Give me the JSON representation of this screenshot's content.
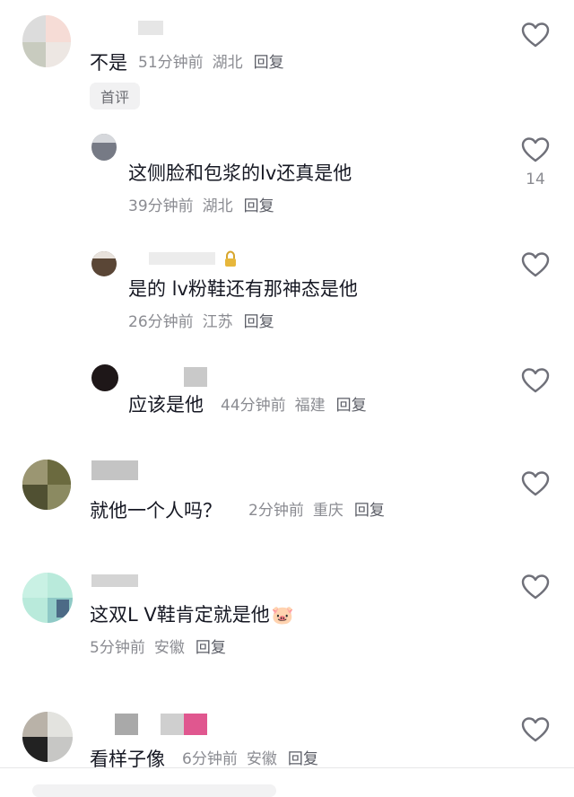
{
  "comments": [
    {
      "text": "不是",
      "time": "51分钟前",
      "location": "湖北",
      "reply_label": "回复",
      "badge": "首评"
    },
    {
      "text": "这侧脸和包浆的lv还真是他",
      "time": "39分钟前",
      "location": "湖北",
      "reply_label": "回复",
      "likes": "14"
    },
    {
      "text": "是的 lv粉鞋还有那神态是他",
      "time": "26分钟前",
      "location": "江苏",
      "reply_label": "回复"
    },
    {
      "text": "应该是他",
      "time": "44分钟前",
      "location": "福建",
      "reply_label": "回复"
    },
    {
      "text": "就他一个人吗？",
      "time": "2分钟前",
      "location": "重庆",
      "reply_label": "回复"
    },
    {
      "text": "这双L V鞋肯定就是他",
      "emoji": "🐷",
      "time": "5分钟前",
      "location": "安徽",
      "reply_label": "回复"
    },
    {
      "text": "看样子像",
      "time": "6分钟前",
      "location": "安徽",
      "reply_label": "回复"
    }
  ],
  "icons": {
    "like": "heart-outline-icon",
    "name_badge": "lock-icon"
  },
  "colors": {
    "text": "#161823",
    "meta": "#8a8b91",
    "reply": "#5b5d66",
    "heart": "#6f7079",
    "badge_bg": "#f1f1f2"
  }
}
